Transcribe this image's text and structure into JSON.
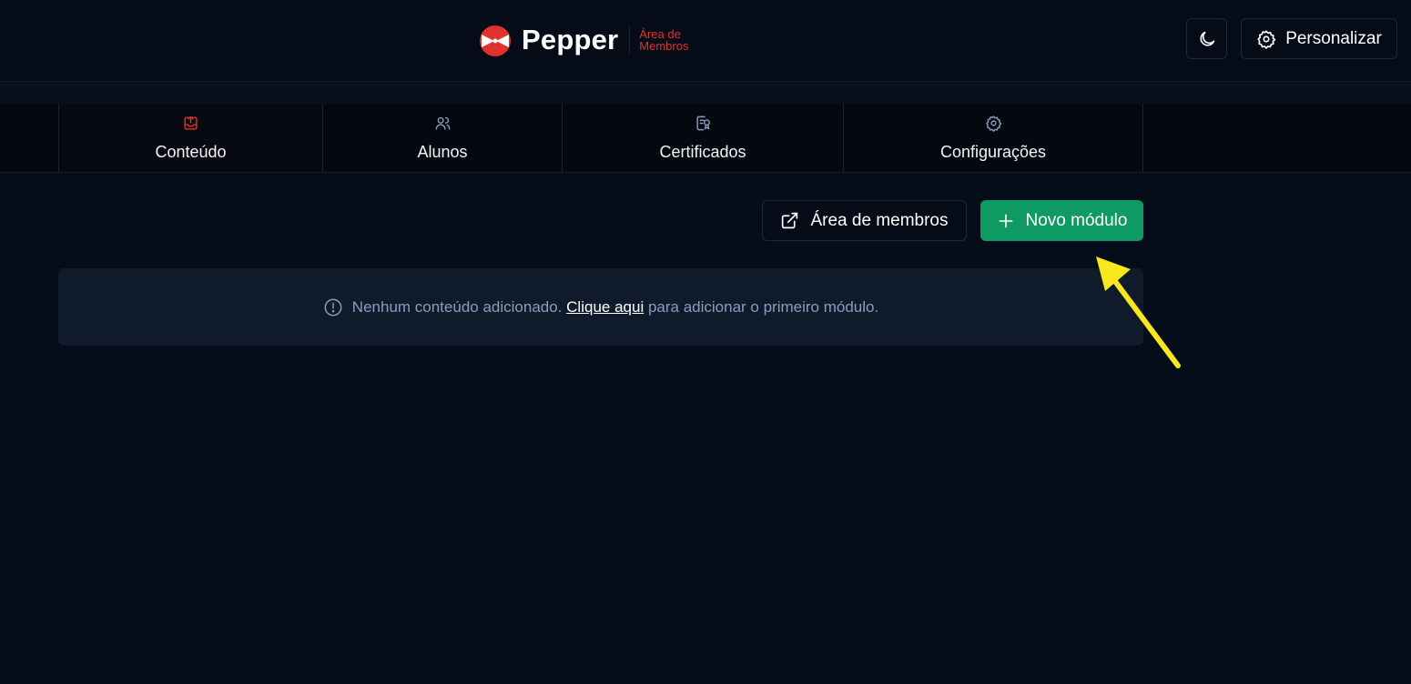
{
  "header": {
    "brand_name": "Pepper",
    "brand_subtitle": "Área de Membros",
    "theme_icon": "moon-icon",
    "customize_label": "Personalizar",
    "customize_icon": "gear-icon"
  },
  "tabs": [
    {
      "label": "Conteúdo",
      "icon": "upload-box-icon",
      "active": true
    },
    {
      "label": "Alunos",
      "icon": "users-icon",
      "active": false
    },
    {
      "label": "Certificados",
      "icon": "certificate-icon",
      "active": false
    },
    {
      "label": "Configurações",
      "icon": "gear-icon",
      "active": false
    }
  ],
  "actions": {
    "members_area_label": "Área de membros",
    "members_area_icon": "external-link-icon",
    "new_module_label": "Novo módulo",
    "new_module_icon": "plus-icon"
  },
  "empty_state": {
    "icon": "info-icon",
    "text_before": "Nenhum conteúdo adicionado.",
    "link_text": "Clique aqui",
    "text_after": "para adicionar o primeiro módulo."
  },
  "colors": {
    "background": "#050d1a",
    "brand_red": "#e0312d",
    "primary_green": "#109a63",
    "annotation_yellow": "#f8e71c"
  }
}
